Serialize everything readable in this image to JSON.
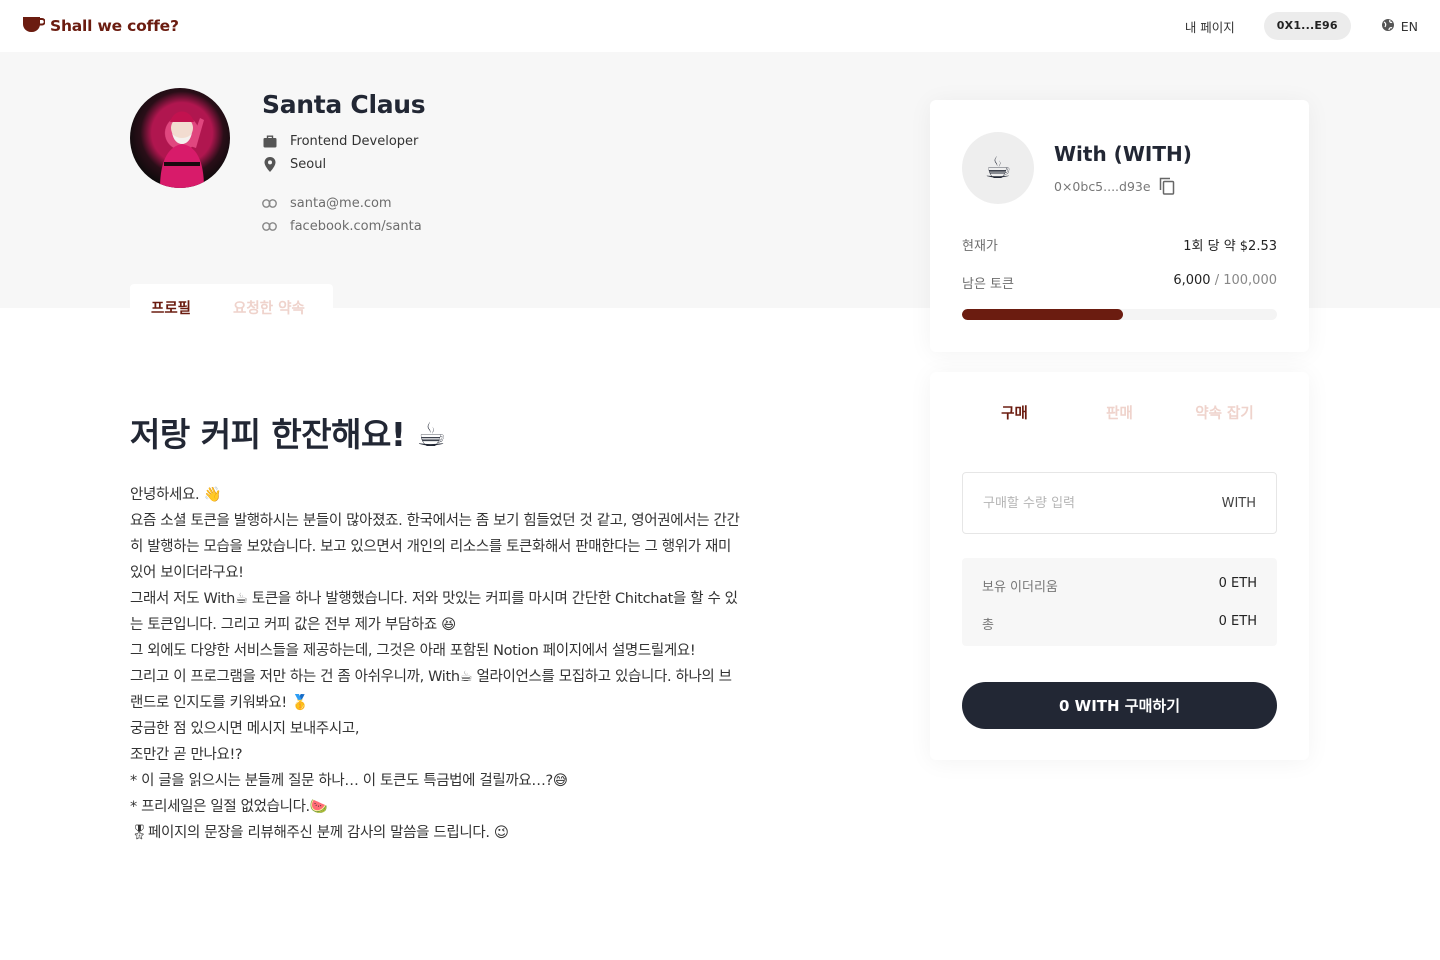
{
  "header": {
    "logo_text": "Shall we coffe?",
    "nav_my_page": "내 페이지",
    "wallet": "0X1...E96",
    "lang": "EN"
  },
  "profile": {
    "name": "Santa Claus",
    "job": "Frontend Developer",
    "location": "Seoul",
    "email": "santa@me.com",
    "facebook": "facebook.com/santa"
  },
  "profile_tabs": {
    "profile": "프로필",
    "requested": "요청한 약속"
  },
  "content": {
    "title": "저랑 커피 한잔해요! ☕",
    "bio_lines": [
      "안녕하세요. 👋",
      "요즘 소셜 토큰을 발행하시는 분들이 많아졌죠. 한국에서는 좀 보기 힘들었던 것 같고, 영어권에서는 간간",
      "히 발행하는 모습을 보았습니다. 보고 있으면서 개인의 리소스를 토큰화해서 판매한다는 그 행위가 재미",
      "있어 보이더라구요!",
      "그래서 저도 With☕ 토큰을 하나 발행했습니다. 저와 맛있는 커피를 마시며 간단한 Chitchat을 할 수 있",
      "는 토큰입니다. 그리고 커피 값은 전부 제가 부담하죠 😆",
      "그 외에도 다양한 서비스들을 제공하는데, 그것은 아래 포함된 Notion 페이지에서 설명드릴게요!",
      "그리고 이 프로그램을 저만 하는 건 좀 아쉬우니까, With☕ 얼라이언스를 모집하고 있습니다. 하나의 브",
      "랜드로 인지도를 키워봐요! 🥇",
      "궁금한 점 있으시면 메시지 보내주시고,",
      "조만간 곧 만나요!?",
      "* 이 글을 읽으시는 분들께 질문 하나… 이 토큰도 특금법에 걸릴까요…?😅",
      "* 프리세일은 일절 없었습니다.🍉",
      "🎖페이지의 문장을 리뷰해주신 분께 감사의 말씀을 드립니다. 😉"
    ]
  },
  "token": {
    "icon": "☕",
    "name": "With (WITH)",
    "address": "0×0bc5....d93e",
    "price_label": "현재가",
    "price_value": "1회 당 약 $2.53",
    "remaining_label": "남은 토큰",
    "remaining_value": "6,000",
    "total_value": "/ 100,000",
    "remaining_ratio": 0.51
  },
  "trade": {
    "tabs": [
      "구매",
      "판매",
      "약속 잡기"
    ],
    "input_placeholder": "구매할 수량 입력",
    "unit": "WITH",
    "eth_label": "보유 이더리움",
    "eth_value": "0 ETH",
    "total_label": "총",
    "total_value": "0 ETH",
    "buy_button": "0 WITH 구매하기"
  },
  "colors": {
    "brand": "#6b1c10",
    "brand_light": "#efd3cc",
    "dark_button": "#222734"
  }
}
